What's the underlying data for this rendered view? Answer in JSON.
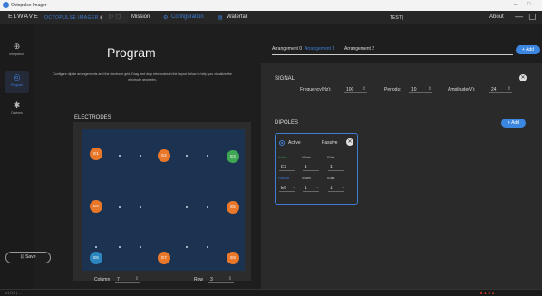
{
  "window": {
    "title": "Octopulse Imager",
    "controls": [
      "–",
      "□"
    ]
  },
  "header": {
    "brand": "ELWAVE",
    "product": "OCTOPULSE IMAGER",
    "nav": [
      {
        "label": "Mission",
        "icon": "rocket-icon"
      },
      {
        "label": "Configuration",
        "icon": "gear-icon",
        "active": true
      },
      {
        "label": "Waterfall",
        "icon": "waterfall-icon"
      }
    ],
    "test_label": "TEST |",
    "about": "About"
  },
  "sidebar": {
    "items": [
      {
        "label": "Integration",
        "icon": "integration-icon"
      },
      {
        "label": "Program",
        "icon": "program-icon",
        "active": true
      },
      {
        "label": "Devices",
        "icon": "devices-icon"
      }
    ],
    "save_label": "Save",
    "save_icon": "save-icon"
  },
  "program": {
    "title": "Program",
    "description": "Configure dipole arrangements and the electrode grid. Drag and drop electrodes in the layout below to help you visualize the electrode geometry.",
    "electrodes_title": "ELECTRODES",
    "electrodes": [
      {
        "label": "E1",
        "color": "orange"
      },
      {
        "label": "E2",
        "color": "orange"
      },
      {
        "label": "E3",
        "color": "green"
      },
      {
        "label": "E4",
        "color": "orange"
      },
      {
        "label": "E5",
        "color": "orange"
      },
      {
        "label": "E6",
        "color": "blue"
      },
      {
        "label": "E7",
        "color": "orange"
      },
      {
        "label": "E8",
        "color": "orange"
      }
    ],
    "column_label": "Column",
    "column_value": "7",
    "row_label": "Row",
    "row_value": "3"
  },
  "arrangements": {
    "tabs": [
      {
        "label": "Arrangement 0",
        "active": false
      },
      {
        "label": "Arrangement 1",
        "active": true
      },
      {
        "label": "Arrangement 2",
        "active": false
      }
    ],
    "add_label": "+ Add"
  },
  "signal": {
    "title": "SIGNAL",
    "frequency_label": "Frequency(Hz):",
    "frequency_value": "100",
    "periods_label": "Periods:",
    "periods_value": "10",
    "amplitude_label": "Amplitude(V):",
    "amplitude_value": "24"
  },
  "dipoles": {
    "title": "DIPOLES",
    "add_label": "+ Add",
    "card": {
      "active_label": "Active",
      "passive_label": "Passive",
      "col_header_1": "VGain",
      "col_header_2": "IGain",
      "row1_tag": "Active",
      "row1_electrode": "E3",
      "row1_vgain": "1",
      "row1_igain": "1",
      "row2_tag": "Passive",
      "row2_electrode": "E6",
      "row2_vgain": "1",
      "row2_igain": "1"
    }
  },
  "status": {
    "left": "v1.0.0 | ...",
    "right": "■ ▲ ■ ▲"
  },
  "colors": {
    "accent": "#3e7fd6",
    "orange": "#e8772a",
    "green": "#3fa654",
    "blue": "#2e86c1",
    "grid": "#1b3350"
  }
}
